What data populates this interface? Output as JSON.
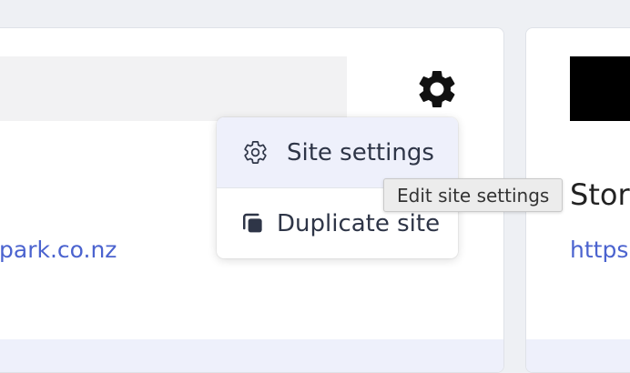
{
  "left_card": {
    "link_text": "park.co.nz"
  },
  "right_card": {
    "title": "Stor",
    "link_text": "https"
  },
  "context_menu": {
    "items": [
      {
        "label": "Site settings",
        "icon": "gear-outline-icon"
      },
      {
        "label": "Duplicate site",
        "icon": "duplicate-icon"
      }
    ]
  },
  "tooltip": {
    "text": "Edit site settings"
  },
  "colors": {
    "page_bg": "#eef0f4",
    "link": "#4b63cf",
    "menu_hover": "#eef0fb",
    "text_dark": "#2e3547"
  }
}
